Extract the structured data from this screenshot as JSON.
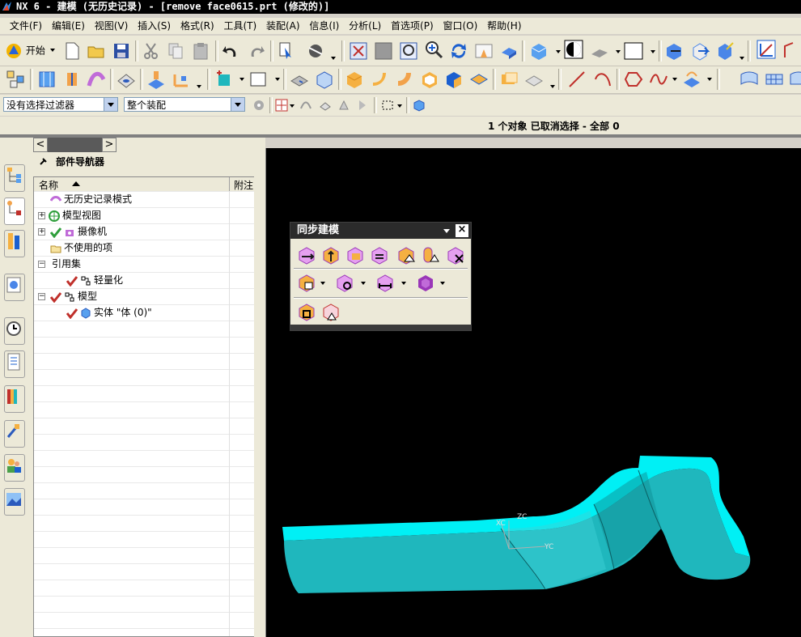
{
  "window": {
    "title": "NX 6 - 建模 (无历史记录) - [remove face0615.prt (修改的)]"
  },
  "menubar": {
    "items": [
      "文件(F)",
      "编辑(E)",
      "视图(V)",
      "插入(S)",
      "格式(R)",
      "工具(T)",
      "装配(A)",
      "信息(I)",
      "分析(L)",
      "首选项(P)",
      "窗口(O)",
      "帮助(H)"
    ]
  },
  "toolbar": {
    "start_label": "开始"
  },
  "filter": {
    "selection_filter": "没有选择过滤器",
    "assembly_scope": "整个装配"
  },
  "status": {
    "message": "1 个对象 已取消选择 - 全部 0"
  },
  "navigator": {
    "title": "部件导航器",
    "col_name": "名称",
    "col_note": "附注",
    "rows": [
      {
        "label": "无历史记录模式"
      },
      {
        "label": "模型视图"
      },
      {
        "label": "摄像机"
      },
      {
        "label": "不使用的项"
      },
      {
        "label": "引用集"
      },
      {
        "label": "轻量化"
      },
      {
        "label": "模型"
      },
      {
        "label": "实体 \"体 (0)\""
      }
    ]
  },
  "sync_toolbar": {
    "title": "同步建模"
  },
  "viewport": {
    "triad": {
      "x_label": "XC",
      "y_label": "YC",
      "z_label": "ZC"
    },
    "part_color": "#1fb7bd",
    "edge_color": "#00f0f5"
  }
}
